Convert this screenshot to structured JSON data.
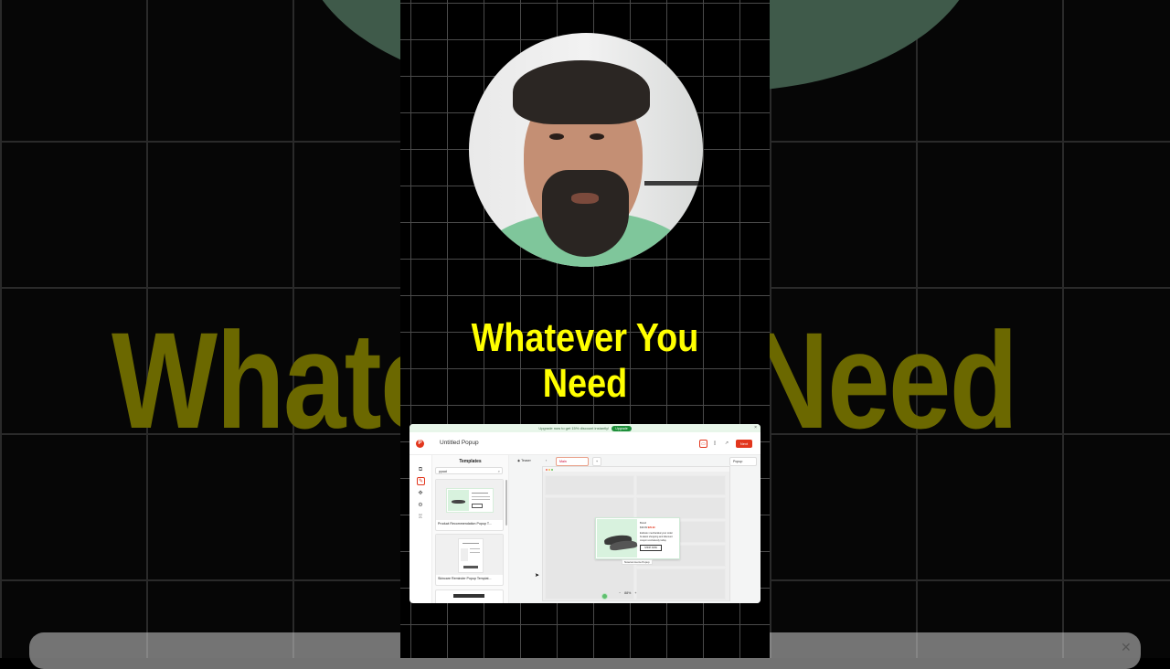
{
  "video": {
    "headline": "Whatever You Need",
    "background_text_left": "Whate",
    "background_text_right": "u Need",
    "accent_color": "#ffff00"
  },
  "app": {
    "promo": {
      "text": "Upgrade now to get 15% discount instantly!",
      "button": "Upgrade"
    },
    "topbar": {
      "title": "Untitled Popup",
      "next_label": "Next"
    },
    "templates": {
      "heading": "Templates",
      "search_value": "ppaat",
      "items": [
        {
          "name": "Product Recommendation Popup T..."
        },
        {
          "name": "Skincare Reminder Popup Templat..."
        }
      ]
    },
    "canvas": {
      "trigger_label": "Teaser",
      "device_value": "Main",
      "type_value": "Popup",
      "zoom_value": "88%",
      "zoom_minus": "−",
      "zoom_plus": "+",
      "popup_label": "Nowcommerce Popup",
      "popup": {
        "eyebrow": "Brand",
        "old_price": "$39.99",
        "price": "$29.99",
        "desc_1": "Exklusiv mechanikal your order",
        "desc_2": "bi-latest shopping and discount",
        "desc_3": "coupon exclusively today",
        "cta": "SHOP NOW"
      }
    }
  }
}
